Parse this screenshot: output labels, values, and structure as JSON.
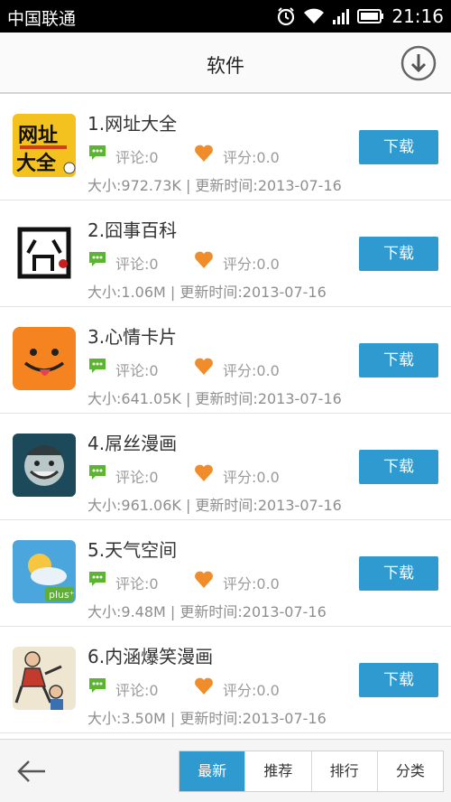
{
  "status_bar": {
    "carrier": "中国联通",
    "time": "21:16"
  },
  "header": {
    "title": "软件"
  },
  "apps": [
    {
      "name": "1.网址大全",
      "comments": "评论:0",
      "score": "评分:0.0",
      "info": "大小:972.73K | 更新时间:2013-07-16",
      "button": "下载"
    },
    {
      "name": "2.囧事百科",
      "comments": "评论:0",
      "score": "评分:0.0",
      "info": "大小:1.06M | 更新时间:2013-07-16",
      "button": "下载"
    },
    {
      "name": "3.心情卡片",
      "comments": "评论:0",
      "score": "评分:0.0",
      "info": "大小:641.05K | 更新时间:2013-07-16",
      "button": "下载"
    },
    {
      "name": "4.屌丝漫画",
      "comments": "评论:0",
      "score": "评分:0.0",
      "info": "大小:961.06K | 更新时间:2013-07-16",
      "button": "下载"
    },
    {
      "name": "5.天气空间",
      "comments": "评论:0",
      "score": "评分:0.0",
      "info": "大小:9.48M | 更新时间:2013-07-16",
      "button": "下载"
    },
    {
      "name": "6.内涵爆笑漫画",
      "comments": "评论:0",
      "score": "评分:0.0",
      "info": "大小:3.50M | 更新时间:2013-07-16",
      "button": "下载"
    }
  ],
  "icon_texts": {
    "app1_logo_line1": "网址",
    "app1_logo_line2": "大全",
    "app5_badge": "plus⁺"
  },
  "tabs": [
    {
      "label": "最新",
      "active": true
    },
    {
      "label": "推荐",
      "active": false
    },
    {
      "label": "排行",
      "active": false
    },
    {
      "label": "分类",
      "active": false
    }
  ],
  "colors": {
    "accent": "#2e9ad0",
    "comment_green": "#5cb531",
    "heart_orange": "#f08d2a"
  }
}
